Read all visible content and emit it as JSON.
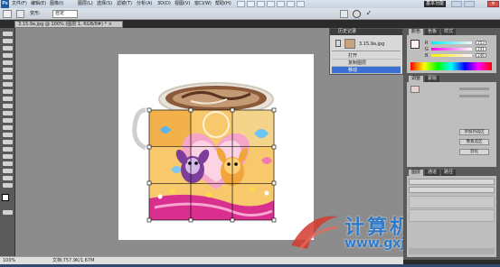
{
  "menubar": {
    "app_badge": "Ps",
    "items": [
      "文件(F)",
      "编辑(E)",
      "图像(I)",
      "图层(L)",
      "选择(S)",
      "滤镜(T)",
      "分析(A)",
      "3D(D)",
      "视图(V)",
      "窗口(W)",
      "帮助(H)"
    ],
    "workspace_label": "基本功能"
  },
  "options": {
    "transform_label": "变形:",
    "warp_style": "自定"
  },
  "document": {
    "tab_title": "3.15.9a.jpg @ 100% (图层 1, RGB/8#) * ×"
  },
  "history": {
    "title": "历史记录",
    "snapshot_name": "3.15.9a.jpg",
    "items": [
      "打开",
      "复制图层",
      "移动"
    ],
    "selected_index": 2
  },
  "color_panel": {
    "tabs": [
      "颜色",
      "色板",
      "样式"
    ],
    "channels": [
      {
        "label": "R",
        "value": "253"
      },
      {
        "label": "G",
        "value": "241"
      },
      {
        "label": "B",
        "value": "246"
      }
    ]
  },
  "adjust_panel": {
    "tabs": [
      "调整",
      "蒙版"
    ],
    "buttons": [
      "添加到选区",
      "像素选区",
      "羽化"
    ]
  },
  "layers_panel": {
    "tabs": [
      "图层",
      "通道",
      "路径"
    ]
  },
  "status": {
    "zoom": "100%",
    "doc_info": "文档:757.9K/1.67M"
  },
  "watermark": {
    "text": "计算机协会",
    "url": "www.gxjmca.com"
  },
  "colors": {
    "history_selected": "#3b6fd1",
    "watermark": "#2e79c8",
    "transform_grid": "#111111"
  }
}
